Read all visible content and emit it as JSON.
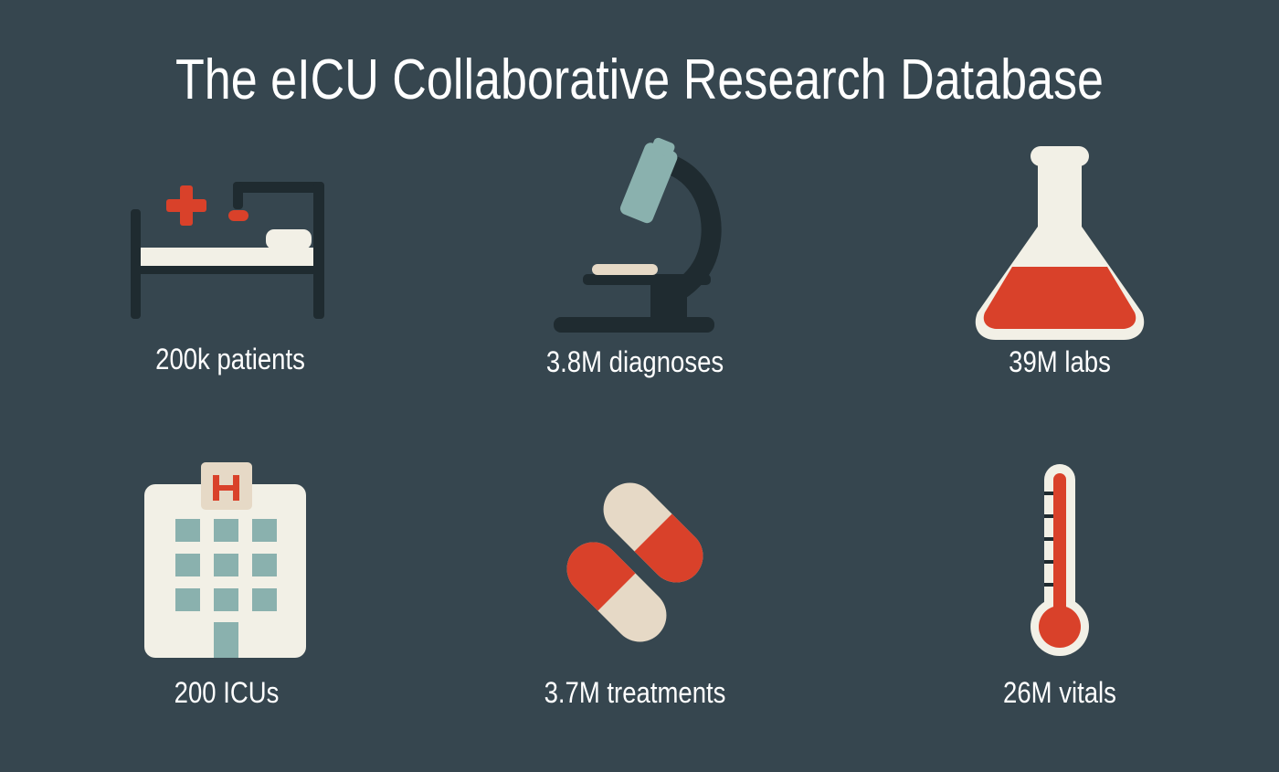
{
  "title": "The eICU Collaborative Research Database",
  "colors": {
    "background": "#36464f",
    "text": "#ffffff",
    "cream": "#f2f0e6",
    "beige": "#e6d9c6",
    "red": "#d9412a",
    "teal": "#8ab1ae",
    "dark": "#1f2b30"
  },
  "stats": [
    {
      "icon": "hospital-bed-icon",
      "label": "200k patients"
    },
    {
      "icon": "microscope-icon",
      "label": "3.8M diagnoses"
    },
    {
      "icon": "flask-icon",
      "label": "39M labs"
    },
    {
      "icon": "hospital-building-icon",
      "label": "200 ICUs"
    },
    {
      "icon": "pills-icon",
      "label": "3.7M treatments"
    },
    {
      "icon": "thermometer-icon",
      "label": "26M vitals"
    }
  ]
}
